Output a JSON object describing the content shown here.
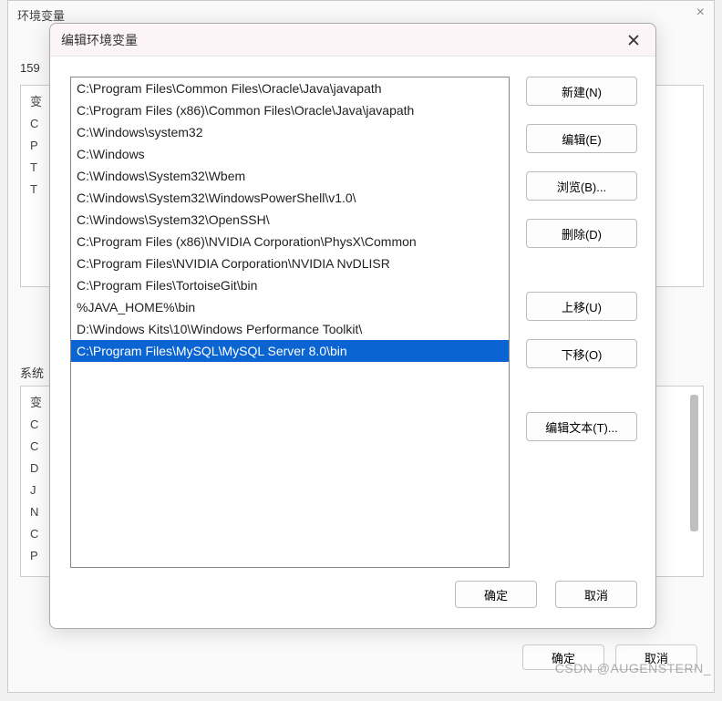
{
  "parent_window": {
    "title": "环境变量",
    "section_1_label": "159",
    "section_2_label": "系统",
    "box1_lines": [
      "变",
      "C",
      "P",
      "T",
      "T"
    ],
    "box2_lines": [
      "变",
      "C",
      "C",
      "D",
      "J",
      "N",
      "C",
      "P"
    ],
    "ok_label": "确定",
    "cancel_label": "取消"
  },
  "dialog": {
    "title": "编辑环境变量",
    "list": {
      "items": [
        "C:\\Program Files\\Common Files\\Oracle\\Java\\javapath",
        "C:\\Program Files (x86)\\Common Files\\Oracle\\Java\\javapath",
        "C:\\Windows\\system32",
        "C:\\Windows",
        "C:\\Windows\\System32\\Wbem",
        "C:\\Windows\\System32\\WindowsPowerShell\\v1.0\\",
        "C:\\Windows\\System32\\OpenSSH\\",
        "C:\\Program Files (x86)\\NVIDIA Corporation\\PhysX\\Common",
        "C:\\Program Files\\NVIDIA Corporation\\NVIDIA NvDLISR",
        "C:\\Program Files\\TortoiseGit\\bin",
        "%JAVA_HOME%\\bin",
        "D:\\Windows Kits\\10\\Windows Performance Toolkit\\",
        "C:\\Program Files\\MySQL\\MySQL Server 8.0\\bin"
      ],
      "selected_index": 12
    },
    "buttons": {
      "new": "新建(N)",
      "edit": "编辑(E)",
      "browse": "浏览(B)...",
      "delete": "删除(D)",
      "move_up": "上移(U)",
      "move_down": "下移(O)",
      "edit_text": "编辑文本(T)..."
    },
    "footer": {
      "ok": "确定",
      "cancel": "取消"
    }
  },
  "watermark": "CSDN @AUGENSTERN_"
}
